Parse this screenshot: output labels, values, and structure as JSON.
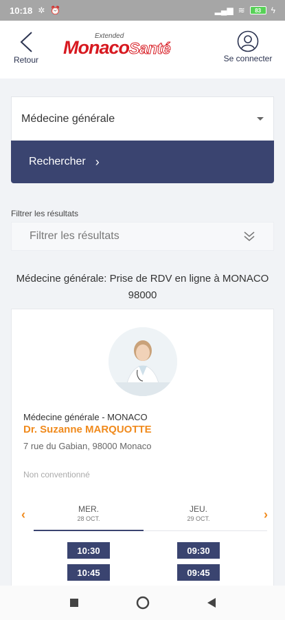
{
  "status_bar": {
    "time": "10:18",
    "battery": "83"
  },
  "header": {
    "back_label": "Retour",
    "logo_small": "Extended",
    "logo_main": "Monaco",
    "logo_secondary": "Santé",
    "connect_label": "Se connecter"
  },
  "search": {
    "specialty_value": "Médecine générale",
    "search_button": "Rechercher"
  },
  "filter": {
    "label": "Filtrer les résultats",
    "placeholder": "Filtrer les résultats"
  },
  "results_title": "Médecine générale: Prise de RDV en ligne à MONACO 98000",
  "doctor": {
    "specialty_line": "Médecine générale - MONACO",
    "name": "Dr. Suzanne MARQUOTTE",
    "address": "7 rue du Gabian, 98000 Monaco",
    "convention": "Non conventionné"
  },
  "days": [
    {
      "name": "MER.",
      "date": "28 OCT.",
      "slots": [
        "10:30",
        "10:45"
      ]
    },
    {
      "name": "JEU.",
      "date": "29 OCT.",
      "slots": [
        "09:30",
        "09:45"
      ]
    }
  ],
  "colors": {
    "accent": "#3a4470",
    "doctor_name": "#f08a1c",
    "logo_red": "#d71920"
  },
  "icons": [
    "back-chevron-icon",
    "user-circle-icon",
    "dropdown-caret-icon",
    "double-chevron-down-icon",
    "square-nav-icon",
    "circle-nav-icon",
    "triangle-back-nav-icon"
  ]
}
